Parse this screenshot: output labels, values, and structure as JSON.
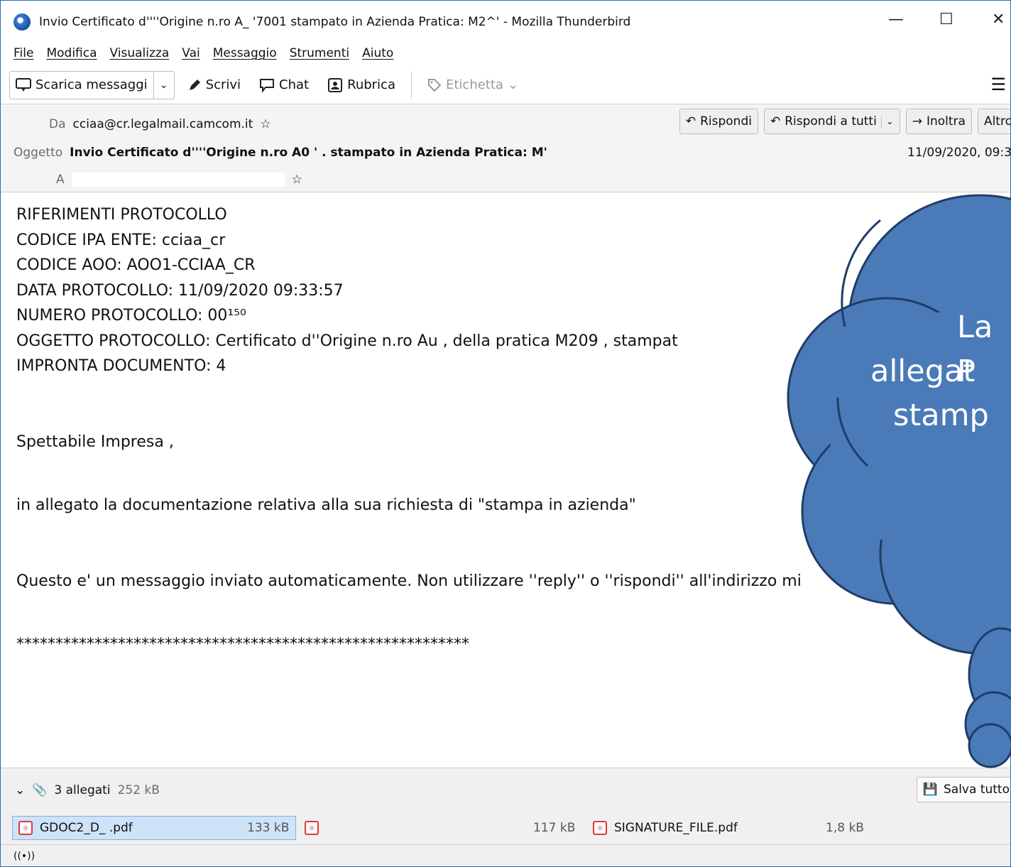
{
  "window": {
    "title": "Invio Certificato d''''Origine n.ro A_ '7001 stampato in Azienda Pratica: M2^' - Mozilla Thunderbird",
    "minimize": "—",
    "maximize": "☐",
    "close": "✕"
  },
  "menu": [
    "File",
    "Modifica",
    "Visualizza",
    "Vai",
    "Messaggio",
    "Strumenti",
    "Aiuto"
  ],
  "toolbar": {
    "get_messages": "Scarica messaggi",
    "write": "Scrivi",
    "chat": "Chat",
    "address_book": "Rubrica",
    "tag": "Etichetta"
  },
  "header": {
    "from_label": "Da",
    "from_value": "cciaa@cr.legalmail.camcom.it",
    "subject_label": "Oggetto",
    "subject_value": "Invio Certificato d''''Origine n.ro A0 ' . stampato in Azienda Pratica: M'",
    "to_label": "A",
    "date": "11/09/2020, 09:3",
    "reply": "Rispondi",
    "reply_all": "Rispondi a tutti",
    "forward": "Inoltra",
    "more": "Altro"
  },
  "body": {
    "lines": [
      "RIFERIMENTI PROTOCOLLO",
      "CODICE IPA ENTE: cciaa_cr",
      "CODICE AOO: AOO1-CCIAA_CR",
      "DATA PROTOCOLLO: 11/09/2020 09:33:57",
      "NUMERO PROTOCOLLO: 00¹⁵⁰",
      "OGGETTO PROTOCOLLO: Certificato d''Origine n.ro Au , della pratica M209 , stampat",
      "IMPRONTA DOCUMENTO: 4"
    ],
    "greeting": "Spettabile Impresa ,",
    "intro": "in allegato la documentazione relativa alla sua richiesta di \"stampa in azienda\"",
    "notice": "Questo e' un messaggio inviato automaticamente. Non utilizzare ''reply'' o ''rispondi'' all'indirizzo mi",
    "stars": "**********************************************************"
  },
  "attachments": {
    "count_label": "3 allegati",
    "total_size": "252 kB",
    "save_all": "Salva tutto",
    "items": [
      {
        "name": "GDOC2_D_ .pdf",
        "size": "133 kB"
      },
      {
        "name": "",
        "size": "117 kB"
      },
      {
        "name": "SIGNATURE_FILE.pdf",
        "size": "1,8 kB"
      }
    ]
  },
  "callout": {
    "lines": [
      "La P",
      "allegat",
      "stamp"
    ],
    "fill": "#4a7ab8",
    "stroke": "#1f3d66"
  },
  "status": {
    "icon": "((•))"
  }
}
